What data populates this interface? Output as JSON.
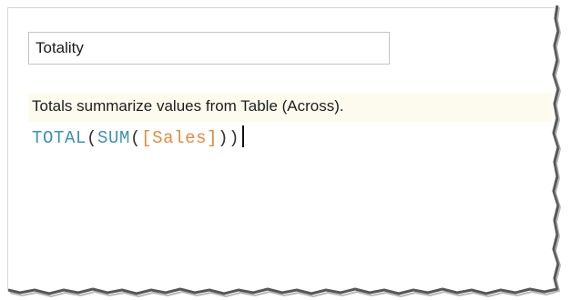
{
  "calculation": {
    "name_value": "Totality",
    "hint": "Totals summarize values from Table (Across).",
    "formula_tokens": {
      "fn_total": "TOTAL",
      "open_1": "(",
      "fn_sum": "SUM",
      "open_2": "(",
      "field": "[Sales]",
      "close_2": ")",
      "close_1": ")"
    }
  },
  "colors": {
    "function": "#3a92b5",
    "field": "#e58a3a",
    "hint_background": "#fcfbee"
  }
}
